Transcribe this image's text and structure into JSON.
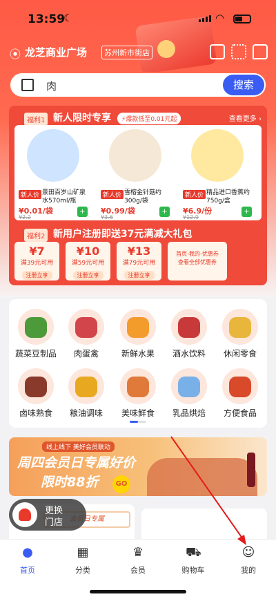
{
  "status": {
    "time": "13:59"
  },
  "location": {
    "name": "龙芝商业广场",
    "store": "苏州新市街店"
  },
  "search": {
    "query": "肉",
    "button": "搜索"
  },
  "promo": {
    "tag1": "福利1",
    "title": "新人限时专享",
    "flash": "⚡爆款低至0.01元起",
    "more": "查看更多 ›",
    "products": [
      {
        "badge": "新人价",
        "name": "景田百岁山矿泉水570ml/瓶",
        "price": "¥0.01/袋",
        "old": "¥2.2",
        "color": "#cfe4ff"
      },
      {
        "badge": "新人价",
        "name": "雪榕金针菇约300g/袋",
        "price": "¥0.99/袋",
        "old": "¥3.6",
        "color": "#f5e8d6"
      },
      {
        "badge": "新人价",
        "name": "精品进口香蕉约750g/盒",
        "price": "¥6.9/份",
        "old": "¥12.9",
        "color": "#ffe9a0"
      }
    ],
    "tag2": "福利2",
    "title2": "新用户注册即送37元满减大礼包",
    "coupons": [
      {
        "amount": "¥7",
        "cond": "满39元可用",
        "get": "注册立享"
      },
      {
        "amount": "¥10",
        "cond": "满59元可用",
        "get": "注册立享"
      },
      {
        "amount": "¥13",
        "cond": "满79元可用",
        "get": "注册立享"
      }
    ],
    "coupon_info": [
      "首页-我的-优惠券",
      "查看全部优惠券"
    ]
  },
  "categories": [
    {
      "label": "蔬菜豆制品",
      "icon": "vegetable-icon",
      "color": "#4c9a3a"
    },
    {
      "label": "肉蛋禽",
      "icon": "meat-icon",
      "color": "#d2454a"
    },
    {
      "label": "新鲜水果",
      "icon": "fruit-icon",
      "color": "#f39b2b"
    },
    {
      "label": "酒水饮料",
      "icon": "drink-icon",
      "color": "#c83a3a"
    },
    {
      "label": "休闲零食",
      "icon": "snack-icon",
      "color": "#e8b63a"
    },
    {
      "label": "卤味熟食",
      "icon": "deli-icon",
      "color": "#8a3a2a"
    },
    {
      "label": "粮油调味",
      "icon": "grain-oil-icon",
      "color": "#e8a820"
    },
    {
      "label": "美味鲜食",
      "icon": "fresh-food-icon",
      "color": "#e07a3a"
    },
    {
      "label": "乳品烘焙",
      "icon": "dairy-icon",
      "color": "#7ab0e8"
    },
    {
      "label": "方便食品",
      "icon": "instant-food-icon",
      "color": "#d84a2a"
    }
  ],
  "banner": {
    "sub": "线上线下 美好会员联动",
    "line1": "周四会员日专属好价",
    "line2": "限时88折",
    "go": "GO"
  },
  "card_strip": "会员日专属",
  "switch_store": {
    "line1": "更换",
    "line2": "门店"
  },
  "tabs": [
    {
      "label": "首页",
      "icon": "home-icon",
      "active": true
    },
    {
      "label": "分类",
      "icon": "category-icon",
      "active": false
    },
    {
      "label": "会员",
      "icon": "member-icon",
      "active": false
    },
    {
      "label": "购物车",
      "icon": "cart-icon",
      "active": false
    },
    {
      "label": "我的",
      "icon": "profile-icon",
      "active": false
    }
  ],
  "colors": {
    "accent": "#3a5cf3",
    "brand_red": "#f04a3a",
    "price_red": "#e8392b",
    "annotation": "#e31b1b"
  }
}
